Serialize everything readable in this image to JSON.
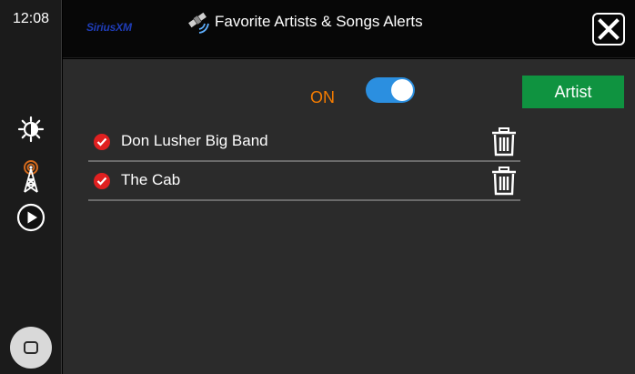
{
  "status": {
    "time": "12:08"
  },
  "header": {
    "logo_text": "SiriusXM",
    "title": "Favorite Artists & Songs Alerts",
    "close_icon": "close-x-icon"
  },
  "rail": {
    "icons": [
      "brightness-icon",
      "radio-tower-icon",
      "play-icon"
    ],
    "home_icon": "home-square-icon"
  },
  "alerts": {
    "status_label": "ON",
    "toggle_on": true,
    "add_button_label": "Artist",
    "items": [
      {
        "label": "Don Lusher Big Band",
        "checked": true
      },
      {
        "label": "The Cab",
        "checked": true
      }
    ]
  },
  "colors": {
    "accent_orange": "#f57c00",
    "toggle_blue": "#2b8fe0",
    "button_green": "#0f9340",
    "check_red": "#e02020",
    "logo_blue": "#1f3db8"
  }
}
